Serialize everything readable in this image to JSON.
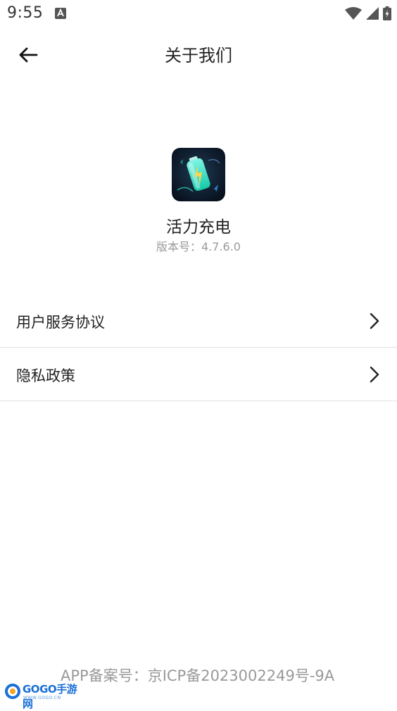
{
  "status_bar": {
    "time": "9:55"
  },
  "header": {
    "title": "关于我们"
  },
  "app": {
    "name": "活力充电",
    "version": "版本号：4.7.6.0"
  },
  "menu": {
    "items": [
      {
        "label": "用户服务协议"
      },
      {
        "label": "隐私政策"
      }
    ]
  },
  "footer": {
    "icp": "APP备案号：京ICP备2023002249号-9A"
  },
  "watermark": {
    "brand": "GOGO手游网",
    "url": "WWW.GOGO.CN"
  },
  "colors": {
    "accent_icon": "#2ee3c0",
    "app_icon_bg": "#0e1a2c",
    "divider": "#e2e2e2",
    "muted_text": "#9a9a9a"
  }
}
